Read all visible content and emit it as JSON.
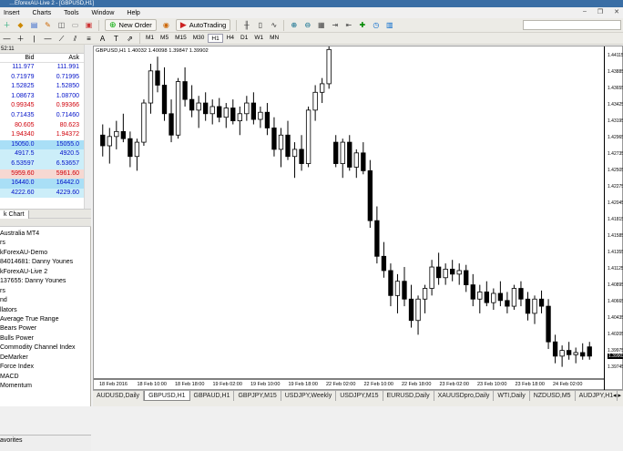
{
  "window": {
    "title": "…EforexAU-Live 2 - [GBPUSD,H1]"
  },
  "menu": [
    "Insert",
    "Charts",
    "Tools",
    "Window",
    "Help"
  ],
  "toolbar": {
    "new_order": "New Order",
    "autotrading": "AutoTrading"
  },
  "timeframes": [
    "M1",
    "M5",
    "M15",
    "M30",
    "H1",
    "H4",
    "D1",
    "W1",
    "MN"
  ],
  "active_timeframe": "H1",
  "market_watch": {
    "time": "52:11",
    "col_bid": "Bid",
    "col_ask": "Ask",
    "rows": [
      {
        "bid": "111.977",
        "ask": "111.991",
        "color": "blue",
        "bg": ""
      },
      {
        "bid": "0.71979",
        "ask": "0.71995",
        "color": "blue",
        "bg": ""
      },
      {
        "bid": "1.52825",
        "ask": "1.52850",
        "color": "blue",
        "bg": ""
      },
      {
        "bid": "1.08673",
        "ask": "1.08700",
        "color": "blue",
        "bg": ""
      },
      {
        "bid": "0.99345",
        "ask": "0.99366",
        "color": "red",
        "bg": ""
      },
      {
        "bid": "0.71435",
        "ask": "0.71460",
        "color": "blue",
        "bg": ""
      },
      {
        "bid": "80.605",
        "ask": "80.623",
        "color": "red",
        "bg": ""
      },
      {
        "bid": "1.94340",
        "ask": "1.94372",
        "color": "red",
        "bg": ""
      },
      {
        "bid": "15050.0",
        "ask": "15055.0",
        "color": "blue",
        "bg": "rowblue"
      },
      {
        "bid": "4917.5",
        "ask": "4920.5",
        "color": "blue",
        "bg": "rowlight"
      },
      {
        "bid": "6.53597",
        "ask": "6.53657",
        "color": "blue",
        "bg": "rowlight"
      },
      {
        "bid": "5959.60",
        "ask": "5961.60",
        "color": "red",
        "bg": "rowpink"
      },
      {
        "bid": "16440.0",
        "ask": "16442.0",
        "color": "blue",
        "bg": "rowblue"
      },
      {
        "bid": "4222.60",
        "ask": "4229.60",
        "color": "blue",
        "bg": "rowlight"
      }
    ],
    "tab_label": "k Chart"
  },
  "navigator": {
    "items": [
      "Australia MT4",
      "rs",
      "kForexAU-Demo",
      "84014681: Danny Younes",
      "kForexAU-Live 2",
      "137655: Danny Younes",
      "rs",
      "nd",
      "llators",
      "Average True Range",
      "Bears Power",
      "Bulls Power",
      "Commodity Channel Index",
      "DeMarker",
      "Force Index",
      "MACD",
      "Momentum"
    ],
    "bottom_tab": "avorites"
  },
  "chart": {
    "info": "GBPUSD,H1  1.40032 1.40098 1.39847 1.39902",
    "current_price": "1.39902",
    "price_labels": [
      "1.44115",
      "1.43885",
      "1.43655",
      "1.43425",
      "1.43195",
      "1.42965",
      "1.42735",
      "1.42505",
      "1.42275",
      "1.42045",
      "1.41815",
      "1.41585",
      "1.41355",
      "1.41125",
      "1.40895",
      "1.40665",
      "1.40435",
      "1.40205",
      "1.39975",
      "1.39745"
    ],
    "time_labels": [
      "18 Feb 2016",
      "18 Feb 10:00",
      "18 Feb 18:00",
      "19 Feb 02:00",
      "19 Feb 10:00",
      "19 Feb 18:00",
      "22 Feb 02:00",
      "22 Feb 10:00",
      "22 Feb 18:00",
      "23 Feb 02:00",
      "23 Feb 10:00",
      "23 Feb 18:00",
      "24 Feb 02:00"
    ]
  },
  "chart_data": {
    "type": "candlestick",
    "title": "GBPUSD,H1",
    "candles": [
      [
        1.43,
        1.4315,
        1.427,
        1.4285
      ],
      [
        1.4285,
        1.431,
        1.426,
        1.4298
      ],
      [
        1.4298,
        1.432,
        1.428,
        1.4305
      ],
      [
        1.4305,
        1.433,
        1.429,
        1.4295
      ],
      [
        1.4295,
        1.4305,
        1.4255,
        1.427
      ],
      [
        1.427,
        1.4295,
        1.425,
        1.429
      ],
      [
        1.429,
        1.435,
        1.4285,
        1.4345
      ],
      [
        1.4345,
        1.44,
        1.433,
        1.439
      ],
      [
        1.439,
        1.441,
        1.436,
        1.437
      ],
      [
        1.437,
        1.4395,
        1.432,
        1.433
      ],
      [
        1.433,
        1.435,
        1.429,
        1.43
      ],
      [
        1.43,
        1.438,
        1.4295,
        1.4375
      ],
      [
        1.4375,
        1.4395,
        1.434,
        1.435
      ],
      [
        1.435,
        1.437,
        1.4325,
        1.4335
      ],
      [
        1.4335,
        1.4355,
        1.431,
        1.4345
      ],
      [
        1.4345,
        1.436,
        1.432,
        1.433
      ],
      [
        1.433,
        1.435,
        1.4315,
        1.434
      ],
      [
        1.434,
        1.4352,
        1.4318,
        1.4325
      ],
      [
        1.4325,
        1.4345,
        1.431,
        1.4338
      ],
      [
        1.4338,
        1.435,
        1.4315,
        1.432
      ],
      [
        1.432,
        1.434,
        1.43,
        1.433
      ],
      [
        1.433,
        1.4355,
        1.432,
        1.4345
      ],
      [
        1.4345,
        1.436,
        1.4315,
        1.4322
      ],
      [
        1.4322,
        1.434,
        1.431,
        1.4332
      ],
      [
        1.4332,
        1.4345,
        1.43,
        1.431
      ],
      [
        1.431,
        1.4325,
        1.427,
        1.428
      ],
      [
        1.428,
        1.431,
        1.4255,
        1.43
      ],
      [
        1.43,
        1.432,
        1.4265,
        1.427
      ],
      [
        1.427,
        1.429,
        1.424,
        1.428
      ],
      [
        1.428,
        1.43,
        1.425,
        1.426
      ],
      [
        1.426,
        1.434,
        1.4255,
        1.4335
      ],
      [
        1.4335,
        1.437,
        1.432,
        1.436
      ],
      [
        1.436,
        1.438,
        1.4345,
        1.4372
      ],
      [
        1.4372,
        1.443,
        1.4365,
        1.442
      ],
      [
        1.429,
        1.43,
        1.4255,
        1.426
      ],
      [
        1.426,
        1.4295,
        1.424,
        1.429
      ],
      [
        1.429,
        1.43,
        1.425,
        1.4255
      ],
      [
        1.4255,
        1.428,
        1.424,
        1.4275
      ],
      [
        1.4275,
        1.429,
        1.4245,
        1.425
      ],
      [
        1.425,
        1.4265,
        1.417,
        1.418
      ],
      [
        1.418,
        1.42,
        1.412,
        1.413
      ],
      [
        1.413,
        1.415,
        1.41,
        1.411
      ],
      [
        1.411,
        1.412,
        1.406,
        1.4075
      ],
      [
        1.4075,
        1.4105,
        1.405,
        1.4095
      ],
      [
        1.4095,
        1.4115,
        1.406,
        1.407
      ],
      [
        1.407,
        1.409,
        1.403,
        1.404
      ],
      [
        1.404,
        1.4075,
        1.402,
        1.407
      ],
      [
        1.407,
        1.409,
        1.405,
        1.4085
      ],
      [
        1.4085,
        1.4125,
        1.4075,
        1.4115
      ],
      [
        1.4115,
        1.4135,
        1.409,
        1.41
      ],
      [
        1.41,
        1.412,
        1.409,
        1.4112
      ],
      [
        1.4112,
        1.4125,
        1.4095,
        1.4105
      ],
      [
        1.4105,
        1.412,
        1.409,
        1.411
      ],
      [
        1.411,
        1.4118,
        1.408,
        1.409
      ],
      [
        1.409,
        1.4105,
        1.406,
        1.407
      ],
      [
        1.407,
        1.409,
        1.405,
        1.408
      ],
      [
        1.408,
        1.4095,
        1.406,
        1.4065
      ],
      [
        1.4065,
        1.4085,
        1.4055,
        1.4078
      ],
      [
        1.4078,
        1.4095,
        1.406,
        1.4068
      ],
      [
        1.4068,
        1.408,
        1.405,
        1.406
      ],
      [
        1.406,
        1.409,
        1.4055,
        1.4085
      ],
      [
        1.4085,
        1.4095,
        1.406,
        1.407
      ],
      [
        1.407,
        1.408,
        1.404,
        1.405
      ],
      [
        1.405,
        1.4075,
        1.4035,
        1.407
      ],
      [
        1.407,
        1.4082,
        1.405,
        1.406
      ],
      [
        1.406,
        1.407,
        1.4,
        1.401
      ],
      [
        1.401,
        1.402,
        1.398,
        1.399
      ],
      [
        1.399,
        1.4005,
        1.3975,
        1.3998
      ],
      [
        1.3998,
        1.401,
        1.3985,
        1.3992
      ],
      [
        1.3992,
        1.4002,
        1.398,
        1.3995
      ],
      [
        1.3995,
        1.4008,
        1.3985,
        1.399
      ],
      [
        1.4003,
        1.401,
        1.3985,
        1.399
      ]
    ]
  }
}
